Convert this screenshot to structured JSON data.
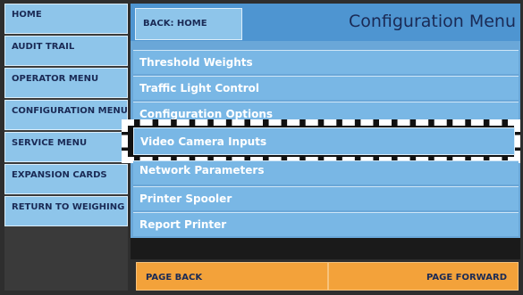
{
  "sidebar": {
    "items": [
      {
        "label": "HOME"
      },
      {
        "label": "AUDIT TRAIL"
      },
      {
        "label": "OPERATOR MENU"
      },
      {
        "label": "CONFIGURATION MENU"
      },
      {
        "label": "SERVICE MENU"
      },
      {
        "label": "EXPANSION CARDS"
      },
      {
        "label": "RETURN TO WEIGHING"
      }
    ]
  },
  "header": {
    "back_label": "BACK: HOME",
    "title": "Configuration Menu"
  },
  "menu": {
    "items": [
      {
        "label": "Threshold Weights"
      },
      {
        "label": "Traffic Light Control"
      },
      {
        "label": "Configuration Options"
      },
      {
        "label": "Video Camera Inputs"
      },
      {
        "label": "Network Parameters"
      },
      {
        "label": "Printer Spooler"
      },
      {
        "label": "Report Printer"
      }
    ],
    "selected_index": 3
  },
  "footer": {
    "page_back": "PAGE BACK",
    "page_forward": "PAGE FORWARD"
  },
  "colors": {
    "nav_button": "#8ec5ea",
    "menu_item": "#79b7e5",
    "header": "#4e95d1",
    "footer_button": "#f3a23a",
    "text_dark": "#1a2a55"
  }
}
